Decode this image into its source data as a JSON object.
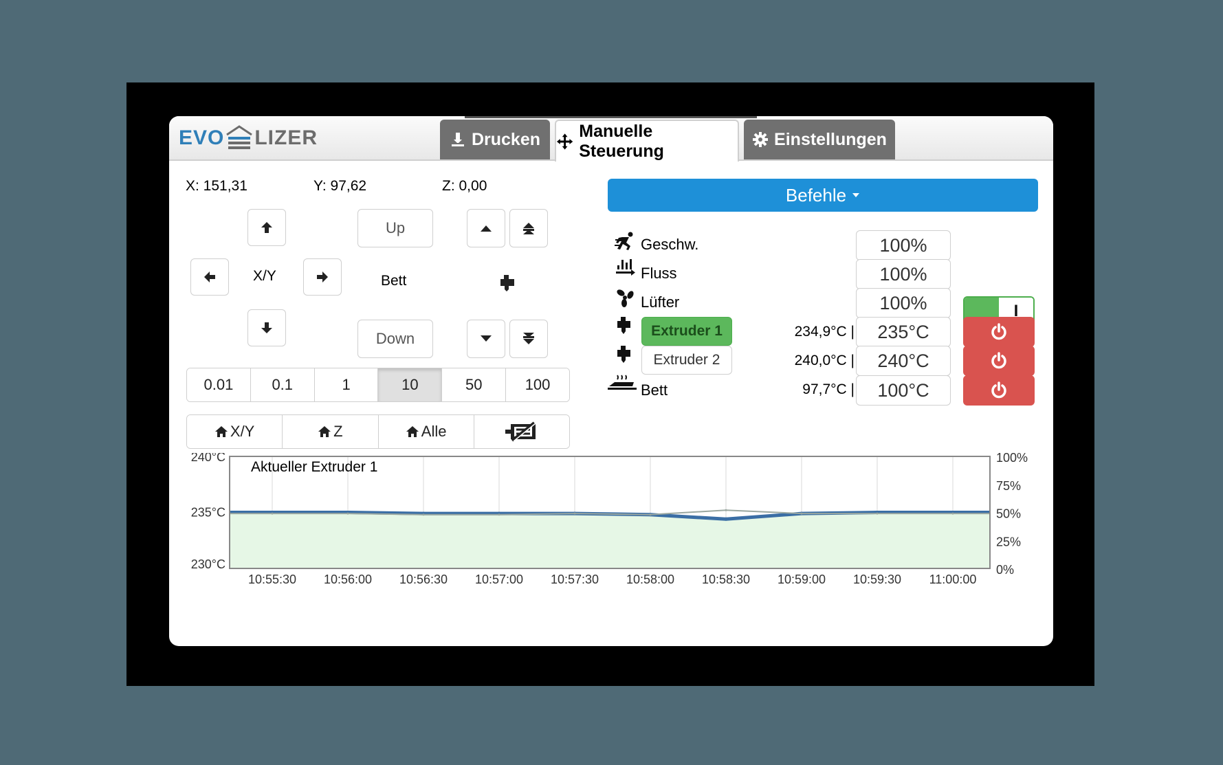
{
  "logo": {
    "left": "EVO",
    "right": "LIZER"
  },
  "tabs": [
    {
      "label": "Drucken",
      "icon": "printer-icon",
      "active": false
    },
    {
      "label": "Manuelle Steuerung",
      "icon": "move-icon",
      "active": true
    },
    {
      "label": "Einstellungen",
      "icon": "gear-icon",
      "active": false
    }
  ],
  "position": {
    "x": "X: 151,31",
    "y": "Y: 97,62",
    "z": "Z: 0,00"
  },
  "jog": {
    "xy_label": "X/Y",
    "bed_label": "Bett",
    "up_label": "Up",
    "down_label": "Down"
  },
  "step_sizes": [
    "0.01",
    "0.1",
    "1",
    "10",
    "50",
    "100"
  ],
  "selected_step": "10",
  "home": {
    "xy": "X/Y",
    "z": "Z",
    "all": "Alle"
  },
  "commands_label": "Befehle",
  "controls": {
    "speed": {
      "label": "Geschw.",
      "value": "100%"
    },
    "flow": {
      "label": "Fluss",
      "value": "100%"
    },
    "fan": {
      "label": "Lüfter",
      "value": "100%",
      "toggle": "I"
    },
    "extruder1": {
      "label": "Extruder 1",
      "current": "234,9°C |",
      "target": "235°C",
      "active": true
    },
    "extruder2": {
      "label": "Extruder 2",
      "current": "240,0°C |",
      "target": "240°C",
      "active": false
    },
    "bed": {
      "label": "Bett",
      "current": "97,7°C |",
      "target": "100°C"
    }
  },
  "colors": {
    "accent": "#1e90d8",
    "success": "#5cb85c",
    "danger": "#d9534f",
    "series": "#3a6ea5",
    "fill": "#e6f7e6"
  },
  "chart_data": {
    "type": "line",
    "title": "Aktueller Extruder 1",
    "x": [
      "10:55:30",
      "10:56:00",
      "10:56:30",
      "10:57:00",
      "10:57:30",
      "10:58:00",
      "10:58:30",
      "10:59:00",
      "10:59:30",
      "11:00:00"
    ],
    "y_left_ticks": [
      "240°C",
      "235°C",
      "230°C"
    ],
    "y_right_ticks": [
      "100%",
      "75%",
      "50%",
      "25%",
      "0%"
    ],
    "ylim": [
      230,
      240
    ],
    "series": [
      {
        "values": [
          235.0,
          235.0,
          234.9,
          234.9,
          234.9,
          234.8,
          234.4,
          234.9,
          235.0,
          235.0
        ]
      },
      {
        "values": [
          234.9,
          234.9,
          234.8,
          234.8,
          234.9,
          234.8,
          235.2,
          234.9,
          234.9,
          234.9
        ]
      }
    ],
    "grid": true
  }
}
